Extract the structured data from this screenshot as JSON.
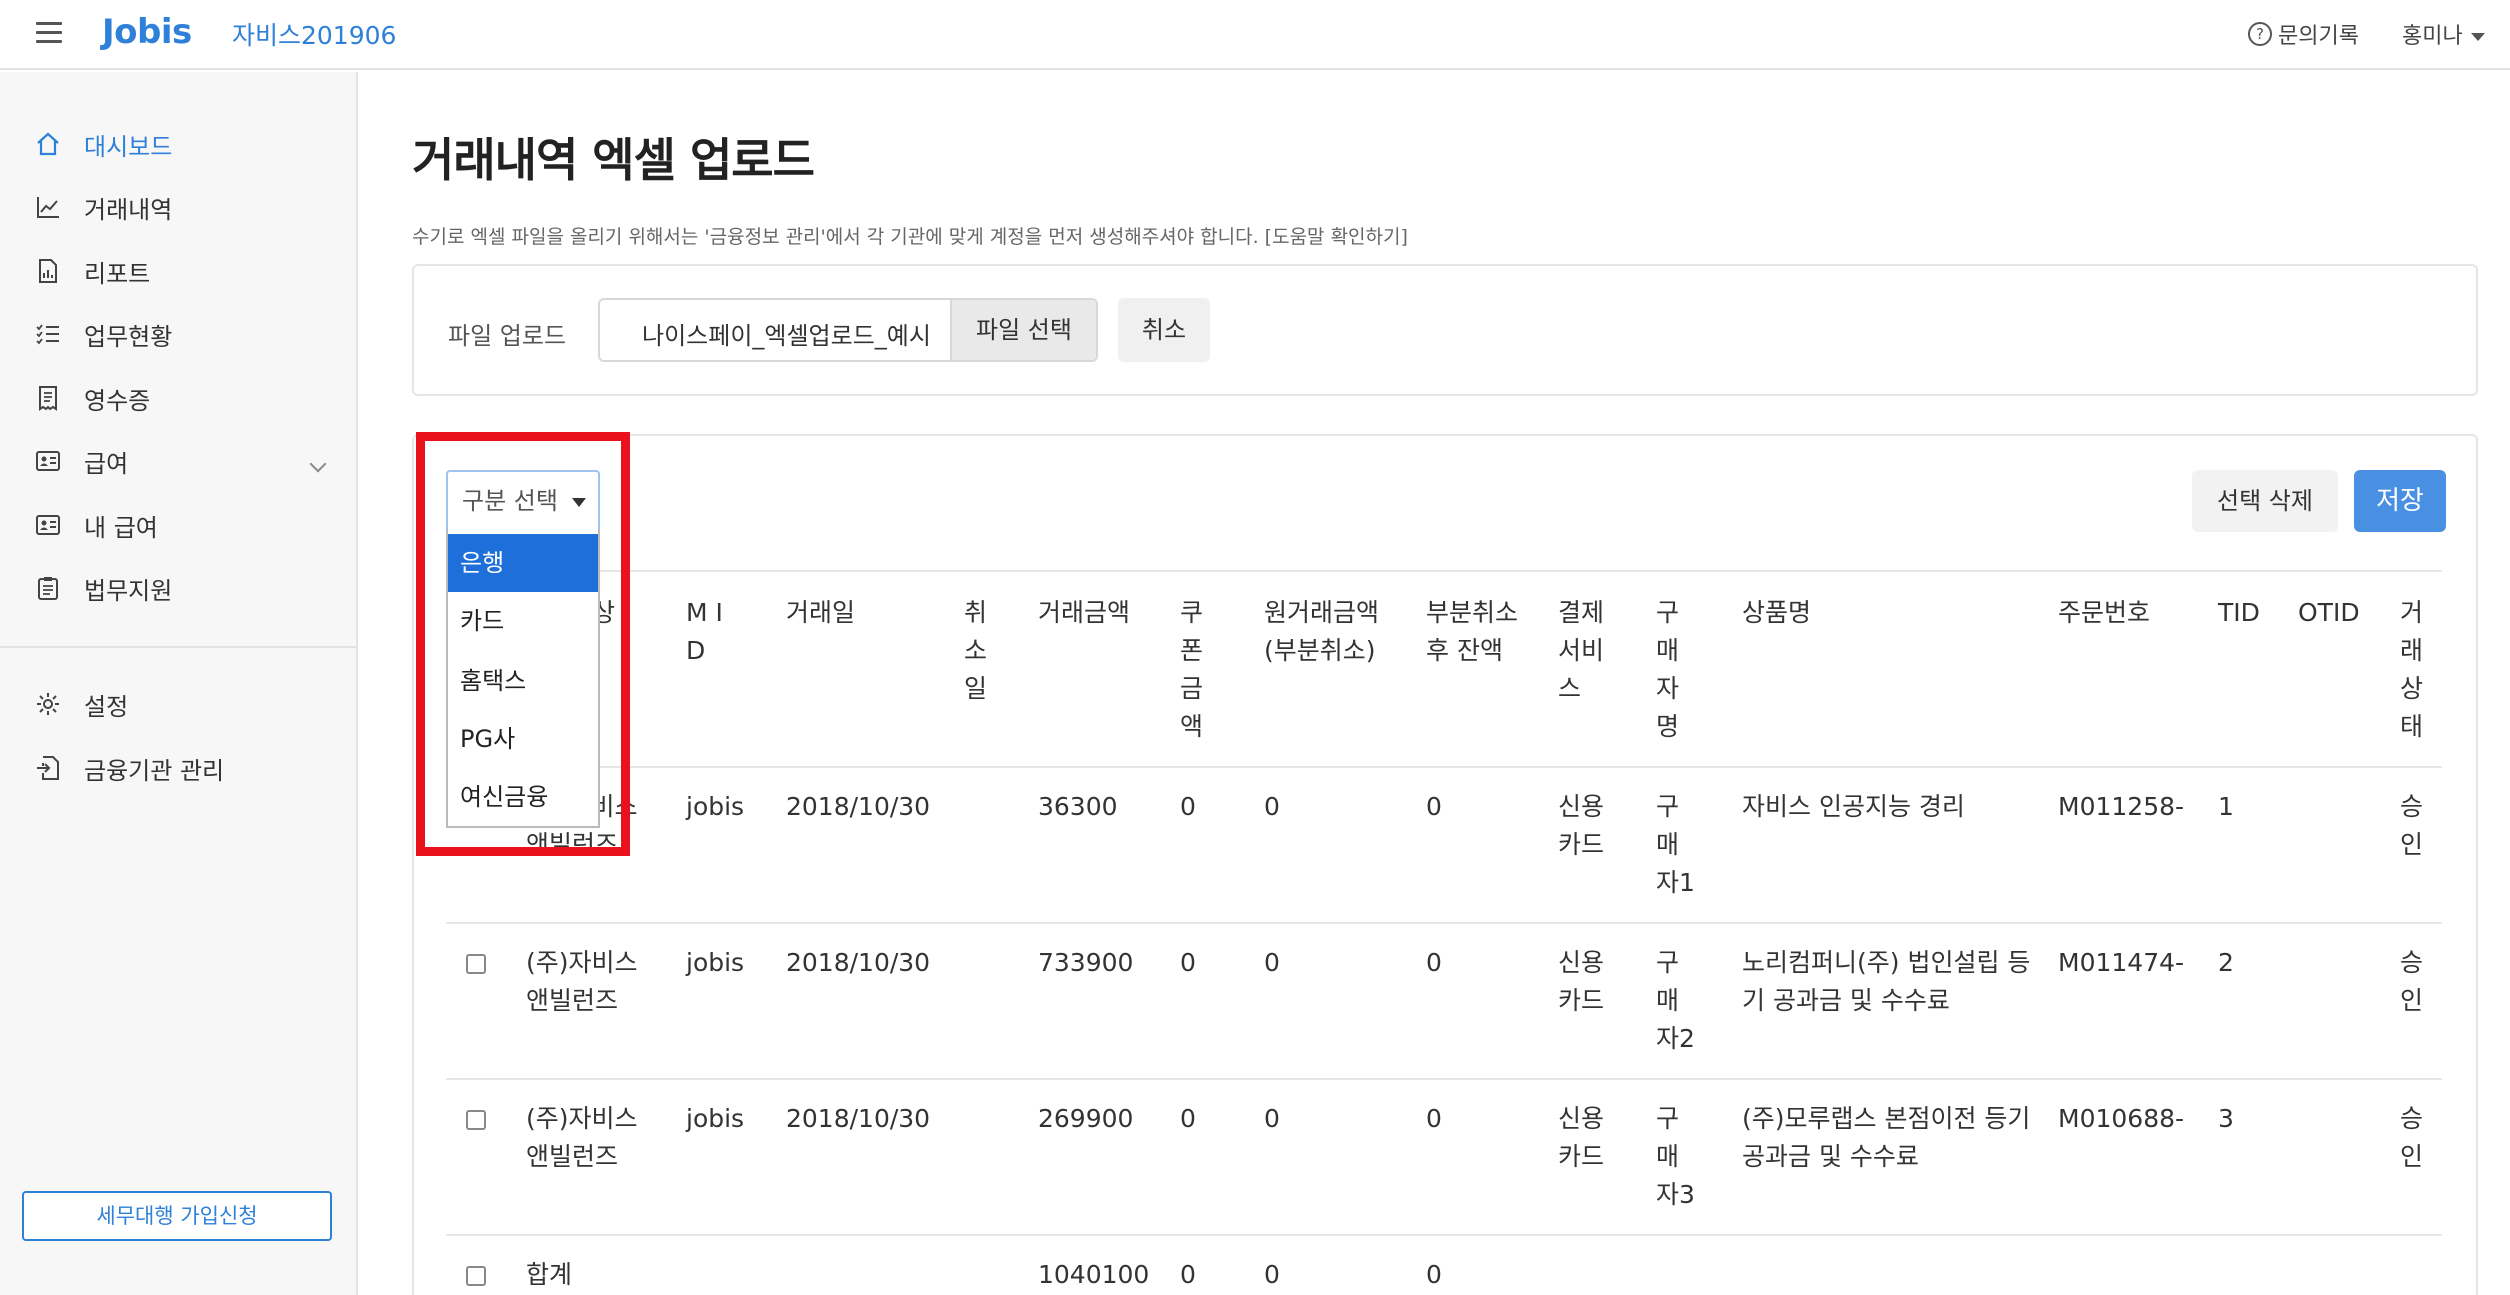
{
  "header": {
    "logo": "Jobis",
    "company": "자비스201906",
    "inquiry_label": "문의기록",
    "user_name": "홍미나"
  },
  "sidebar": {
    "items": [
      {
        "label": "대시보드",
        "icon": "home-icon",
        "active": true
      },
      {
        "label": "거래내역",
        "icon": "chart-line-icon"
      },
      {
        "label": "리포트",
        "icon": "report-file-icon"
      },
      {
        "label": "업무현황",
        "icon": "checklist-icon"
      },
      {
        "label": "영수증",
        "icon": "receipt-icon"
      },
      {
        "label": "급여",
        "icon": "id-card-icon",
        "has_submenu": true
      },
      {
        "label": "내 급여",
        "icon": "id-card-icon"
      },
      {
        "label": "법무지원",
        "icon": "clipboard-icon"
      },
      {
        "label": "설정",
        "icon": "gear-icon"
      },
      {
        "label": "금융기관 관리",
        "icon": "file-import-icon"
      }
    ],
    "signup_button": "세무대행 가입신청"
  },
  "main": {
    "title": "거래내역 엑셀 업로드",
    "notice": "수기로 엑셀 파일을 올리기 위해서는 '금융정보 관리'에서 각 기관에 맞게 계정을 먼저 생성해주셔야 합니다. [도움말 확인하기]",
    "upload": {
      "label": "파일 업로드",
      "file_name": "나이스페이_엑셀업로드_예시",
      "choose_button": "파일 선택",
      "cancel_button": "취소"
    },
    "actions": {
      "delete_button": "선택 삭제",
      "save_button": "저장"
    },
    "category_select": {
      "placeholder": "구분 선택",
      "options": [
        "은행",
        "카드",
        "홈택스",
        "PG사",
        "여신금융"
      ],
      "highlighted": "은행"
    },
    "table": {
      "headers": {
        "merchant_tail": "상",
        "mid": "M I D",
        "date": "거래일",
        "cancel_date": "취소일",
        "amount": "거래금액",
        "coupon": "쿠폰금액",
        "orig_amount": "원거래금액(부분취소)",
        "remain": "부분취소 후 잔액",
        "pay_service": "결제서비스",
        "buyer": "구매자명",
        "product": "상품명",
        "order_no": "주문번호",
        "tid": "TID",
        "otid": "OTID",
        "status": "거래상태"
      },
      "rows": [
        {
          "merchant": "(주)자비스 앤빌런즈",
          "mid": "jobis",
          "date": "2018/10/30",
          "amount": "36300",
          "coupon": "0",
          "orig": "0",
          "remain": "0",
          "pay": "신용 카드",
          "buyer": "구매자1",
          "product": "자비스 인공지능 경리",
          "order": "M011258-",
          "tid": "1",
          "status": "승인"
        },
        {
          "merchant": "(주)자비스 앤빌런즈",
          "mid": "jobis",
          "date": "2018/10/30",
          "amount": "733900",
          "coupon": "0",
          "orig": "0",
          "remain": "0",
          "pay": "신용 카드",
          "buyer": "구매자2",
          "product": "노리컴퍼니(주) 법인설립 등기 공과금 및 수수료",
          "order": "M011474-",
          "tid": "2",
          "status": "승인"
        },
        {
          "merchant": "(주)자비스 앤빌런즈",
          "mid": "jobis",
          "date": "2018/10/30",
          "amount": "269900",
          "coupon": "0",
          "orig": "0",
          "remain": "0",
          "pay": "신용 카드",
          "buyer": "구매자3",
          "product": "(주)모루랩스 본점이전 등기 공과금 및 수수료",
          "order": "M010688-",
          "tid": "3",
          "status": "승인"
        }
      ],
      "total": {
        "label": "합계",
        "amount": "1040100",
        "coupon": "0",
        "orig": "0",
        "remain": "0"
      }
    }
  }
}
